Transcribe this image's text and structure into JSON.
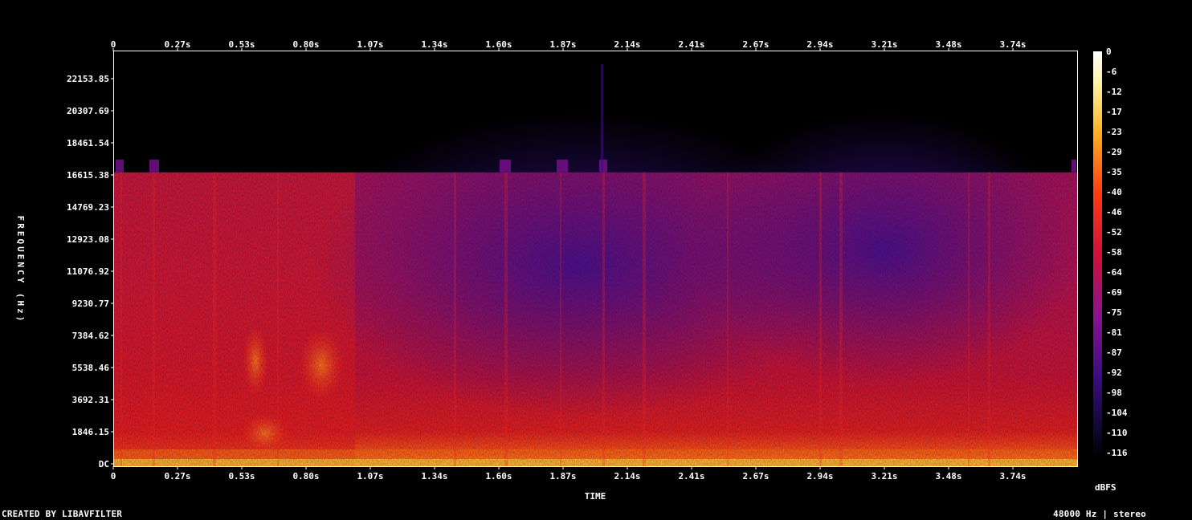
{
  "chart_data": {
    "type": "heatmap",
    "subtype": "spectrogram",
    "xlabel": "TIME",
    "ylabel": "FREQUENCY (Hz)",
    "x_ticks": [
      "0",
      "0.27s",
      "0.53s",
      "0.80s",
      "1.07s",
      "1.34s",
      "1.60s",
      "1.87s",
      "2.14s",
      "2.41s",
      "2.67s",
      "2.94s",
      "3.21s",
      "3.48s",
      "3.74s"
    ],
    "y_ticks": [
      "DC",
      "1846.15",
      "3692.31",
      "5538.46",
      "7384.62",
      "9230.77",
      "11076.92",
      "12923.08",
      "14769.23",
      "16615.38",
      "18461.54",
      "20307.69",
      "22153.85"
    ],
    "xlim": [
      0,
      4.0
    ],
    "ylim": [
      0,
      24000
    ],
    "colorbar": {
      "label": "dBFS",
      "ticks": [
        "0",
        "-6",
        "-12",
        "-17",
        "-23",
        "-29",
        "-35",
        "-40",
        "-46",
        "-52",
        "-58",
        "-64",
        "-69",
        "-75",
        "-81",
        "-87",
        "-92",
        "-98",
        "-104",
        "-110",
        "-116"
      ],
      "range": [
        -120,
        0
      ]
    },
    "frequency_cutoff_hz": 17000,
    "colors": [
      "#000000",
      "#14003a",
      "#3a0a78",
      "#6d1290",
      "#a8146a",
      "#e01820",
      "#ff4a10",
      "#ff9a1a",
      "#ffe060",
      "#ffffff"
    ]
  },
  "footer": {
    "credit": "CREATED BY LIBAVFILTER",
    "sample_info": "48000 Hz | stereo"
  }
}
